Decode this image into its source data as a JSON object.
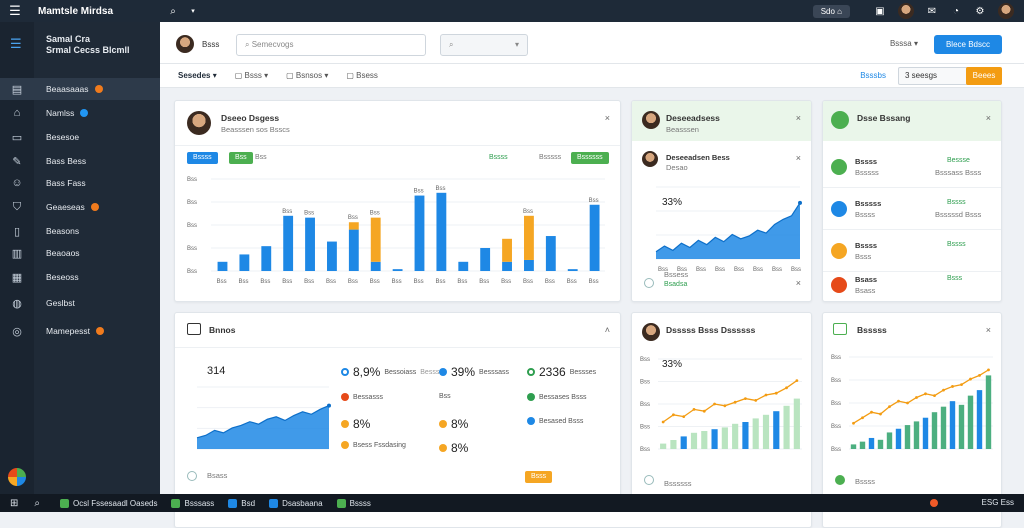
{
  "topbar": {
    "app_title": "Mamtsle Mirdsa",
    "pill_label": "Sdo"
  },
  "sidebar": {
    "title_line1": "Samal Cra",
    "title_line2": "Srmal Cecss Blcmll",
    "items": [
      {
        "label": "Beaasaaas",
        "icon": "dashboard-icon",
        "badge_color": "#f07b1d"
      },
      {
        "label": "Namlss",
        "icon": "home-icon",
        "badge_color": "#2196f3"
      },
      {
        "label": "Besesoe",
        "icon": "briefcase-icon",
        "badge_color": ""
      },
      {
        "label": "Bass Bess",
        "icon": "tools-icon",
        "badge_color": ""
      },
      {
        "label": "Bass Fass",
        "icon": "user-icon",
        "badge_color": ""
      },
      {
        "label": "Geaeseas",
        "icon": "shield-icon",
        "badge_color": "#f07b1d"
      },
      {
        "label": "Beasons",
        "icon": "document-icon",
        "badge_color": ""
      },
      {
        "label": "Beaoaos",
        "icon": "layout-icon",
        "badge_color": ""
      },
      {
        "label": "Beseoss",
        "icon": "book-icon",
        "badge_color": ""
      },
      {
        "label": "Geslbst",
        "icon": "globe-icon",
        "badge_color": ""
      },
      {
        "label": "Mamepesst",
        "icon": "settings-icon",
        "badge_color": "#f07b1d"
      }
    ]
  },
  "header": {
    "search_value": "Semecvogs",
    "filter_label": "Bsssa",
    "new_button": "Blece Bdscc"
  },
  "subnav": {
    "tabs": [
      "Sesedes",
      "Bsss",
      "Bsnsos",
      "Bsess"
    ],
    "range_label": "Bsssbs",
    "range_value": "3 seesgs",
    "export_button": "Beees"
  },
  "card1": {
    "person": "Dseeo Dsgess",
    "role": "Beasssen sos Bsscs",
    "chips": [
      "Bssss",
      "Bss",
      "Bss"
    ],
    "legend": [
      "Bssss",
      "Bsssss"
    ],
    "legend_button": "Bssssss",
    "chart_data": {
      "type": "bar",
      "categories": [
        "Bss",
        "Bss",
        "Bss",
        "Bss",
        "Bss",
        "Bss",
        "Bss",
        "Bss",
        "Bss",
        "Bss",
        "Bss",
        "Bss",
        "Bss",
        "Bss",
        "Bss",
        "Bss",
        "Bss",
        "Bss"
      ],
      "series": [
        {
          "values": [
            10,
            18,
            27,
            60,
            58,
            32,
            45,
            10,
            2,
            82,
            85,
            10,
            25,
            10,
            12,
            38,
            2,
            72
          ]
        },
        {
          "values": [
            0,
            0,
            0,
            0,
            0,
            0,
            8,
            48,
            0,
            0,
            0,
            0,
            0,
            25,
            48,
            0,
            0,
            0
          ]
        }
      ],
      "ylabels": [
        "Bss",
        "Bss",
        "Bss",
        "Bss",
        "Bss"
      ],
      "ylim": [
        0,
        100
      ],
      "colors": [
        "#1e88e5",
        "#f5a623"
      ]
    }
  },
  "card2": {
    "person": "Deseeadsess",
    "role": "Beasssen",
    "stat_person": "Deseeadsen Bess",
    "stat_sub": "Desao",
    "big_value": "33%",
    "footer": "Bssess",
    "footer_sub": "Bsadsa",
    "chart_data": {
      "type": "area",
      "x": [
        1,
        2,
        3,
        4,
        5,
        6,
        7,
        8,
        9,
        10,
        11,
        12,
        13,
        14,
        15,
        16,
        17,
        18
      ],
      "values": [
        10,
        18,
        12,
        22,
        16,
        26,
        20,
        30,
        24,
        34,
        28,
        32,
        40,
        36,
        48,
        55,
        60,
        78
      ],
      "xlabels": [
        "Bss",
        "Bss",
        "Bss",
        "Bss",
        "Bss",
        "Bss",
        "Bss",
        "Bss"
      ],
      "ylim": [
        0,
        100
      ],
      "colors": [
        "#1e88e5"
      ]
    }
  },
  "card3": {
    "title": "Dsse Bssang",
    "rows": [
      {
        "name": "Bssss",
        "sub": "Bsssss",
        "value": "Bessse",
        "value_sub": "Bsssass Bsss",
        "color": "#4caf50"
      },
      {
        "name": "Bsssss",
        "sub": "Bssss",
        "value": "Bssss",
        "value_sub": "Bsssssd Bsss",
        "color": "#1e88e5"
      },
      {
        "name": "Bssss",
        "sub": "Bsss",
        "value": "Bssss",
        "value_sub": "",
        "color": "#f5a623"
      },
      {
        "name": "Bsass",
        "sub": "Bsass",
        "value": "Bsss",
        "value_sub": "",
        "color": "#e64a19"
      }
    ]
  },
  "card4": {
    "title": "Bnnos",
    "big_value": "314",
    "footer": "Bsass",
    "kpis": [
      {
        "label": "Bessoiass",
        "value": "8,9%",
        "sub": "Besssss",
        "color": "#1e88e5",
        "kind": "ring"
      },
      {
        "label": "Besssass",
        "value": "39%",
        "sub": "",
        "color": "#1e88e5",
        "kind": "dot"
      },
      {
        "label": "Bessses",
        "value": "2336",
        "sub": "",
        "color": "#2e9e4f",
        "kind": "ring"
      },
      {
        "label": "Bessasss",
        "value": "",
        "sub": "",
        "color": "#e64a19",
        "kind": "dot"
      },
      {
        "label": "Bss",
        "value": "",
        "sub": "",
        "color": "",
        "kind": "none"
      },
      {
        "label": "Bessases Bsss",
        "value": "",
        "sub": "",
        "color": "#2e9e4f",
        "kind": "dot"
      },
      {
        "label": "",
        "value": "8%",
        "sub": "",
        "color": "#f5a623",
        "kind": "dot"
      },
      {
        "label": "",
        "value": "8%",
        "sub": "",
        "color": "#f5a623",
        "kind": "dot"
      },
      {
        "label": "Besased Bsss",
        "value": "",
        "sub": "",
        "color": "#1e88e5",
        "kind": "dot"
      },
      {
        "label": "Bsess Fssdasing",
        "value": "",
        "sub": "",
        "color": "#f5a623",
        "kind": "dot"
      },
      {
        "label": "",
        "value": "8%",
        "sub": "",
        "color": "#f5a623",
        "kind": "dot"
      }
    ],
    "cta_button": "Bsss",
    "chart_data": {
      "type": "area",
      "x": [
        1,
        2,
        3,
        4,
        5,
        6,
        7,
        8,
        9,
        10,
        11,
        12,
        13,
        14,
        15,
        16
      ],
      "values": [
        18,
        22,
        30,
        26,
        34,
        38,
        44,
        40,
        48,
        52,
        46,
        54,
        60,
        56,
        64,
        70
      ],
      "ylim": [
        0,
        100
      ],
      "colors": [
        "#1e88e5"
      ]
    }
  },
  "card5": {
    "title": "Dsssss Bsss Dssssss",
    "big_value": "33%",
    "footer": "Bssssss",
    "chart_data": {
      "type": "bar",
      "categories": [
        "Bss",
        "Bss",
        "Bss",
        "Bss",
        "Bss",
        "Bss",
        "Bss",
        "Bss",
        "Bss",
        "Bss",
        "Bss",
        "Bss",
        "Bss",
        "Bss"
      ],
      "series": [
        {
          "name": "bars",
          "values": [
            6,
            10,
            14,
            18,
            20,
            22,
            24,
            28,
            30,
            34,
            38,
            42,
            48,
            56
          ]
        },
        {
          "name": "line",
          "values": [
            30,
            38,
            36,
            44,
            42,
            50,
            48,
            52,
            56,
            54,
            60,
            62,
            68,
            76
          ]
        }
      ],
      "ylim": [
        0,
        100
      ],
      "colors": [
        "#1e88e5",
        "#b9e4c0",
        "#f39c12"
      ]
    }
  },
  "card6": {
    "title": "Bsssss",
    "footer": "Bssss",
    "chart_data": {
      "type": "bar",
      "categories": [
        "Bss",
        "Bss",
        "Bss",
        "Bss",
        "Bss",
        "Bss",
        "Bss",
        "Bss",
        "Bss",
        "Bss",
        "Bss",
        "Bss",
        "Bss",
        "Bss",
        "Bss",
        "Bss"
      ],
      "series": [
        {
          "name": "bars",
          "values": [
            5,
            8,
            12,
            10,
            18,
            22,
            26,
            30,
            34,
            40,
            46,
            52,
            48,
            58,
            64,
            80
          ]
        },
        {
          "name": "line",
          "values": [
            28,
            34,
            40,
            38,
            46,
            52,
            50,
            56,
            60,
            58,
            64,
            68,
            70,
            76,
            80,
            86
          ]
        }
      ],
      "ylim": [
        0,
        100
      ],
      "colors": [
        "#1e88e5",
        "#4caf80",
        "#f39c12"
      ]
    }
  },
  "taskbar": {
    "items": [
      {
        "label": "Ocsl Fssesaadl Oaseds",
        "color": "#4caf50"
      },
      {
        "label": "Bsssass",
        "color": "#4caf50"
      },
      {
        "label": "Bsd",
        "color": "#1e88e5"
      },
      {
        "label": "Dsasbaana",
        "color": "#1e88e5"
      },
      {
        "label": "Bssss",
        "color": "#4caf50"
      }
    ],
    "clock": "ESG Ess"
  }
}
